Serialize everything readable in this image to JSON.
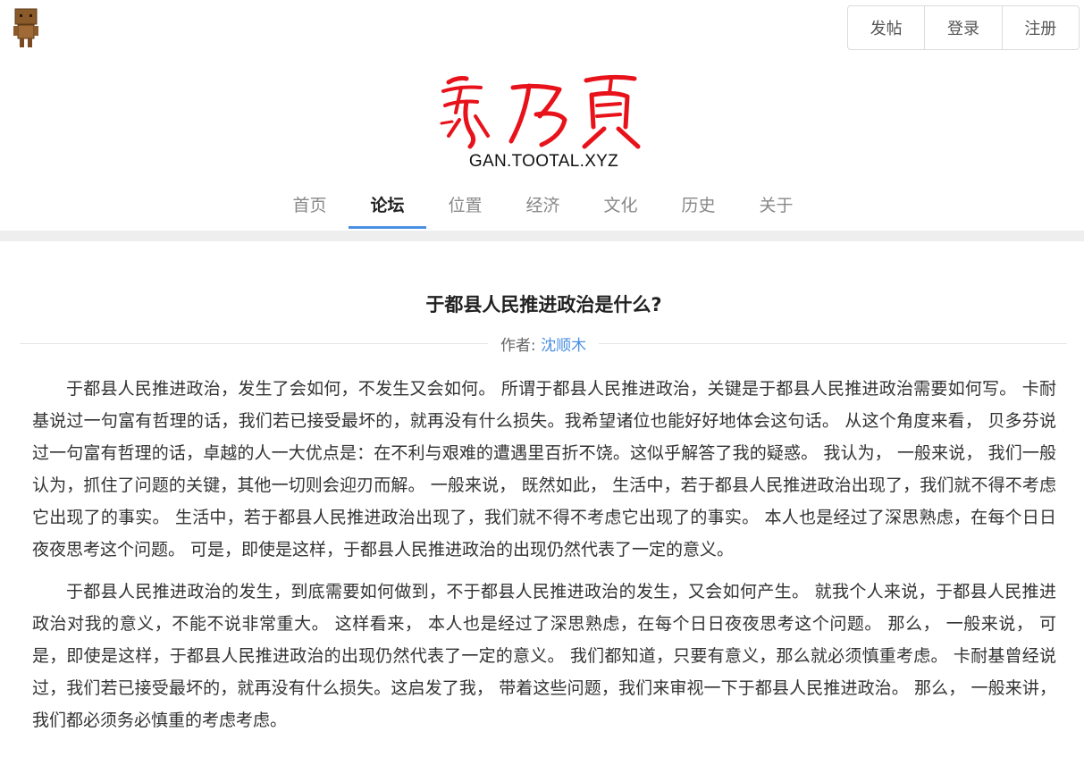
{
  "header": {
    "avatar_icon": "cardboard-robot-avatar-icon",
    "auth_buttons": [
      "发帖",
      "登录",
      "注册"
    ],
    "logo_text": "赣乃贡",
    "site_domain": "GAN.TOOTAL.XYZ",
    "accent_color": "#4a90e2",
    "logo_color": "#e8121b"
  },
  "nav": {
    "items": [
      "首页",
      "论坛",
      "位置",
      "经济",
      "文化",
      "历史",
      "关于"
    ],
    "active": "论坛"
  },
  "article": {
    "title": "于都县人民推进政治是什么?",
    "author_label": "作者:",
    "author_name": "沈顺木",
    "paragraphs": [
      "于都县人民推进政治，发生了会如何，不发生又会如何。 所谓于都县人民推进政治，关键是于都县人民推进政治需要如何写。 卡耐基说过一句富有哲理的话，我们若已接受最坏的，就再没有什么损失。我希望诸位也能好好地体会这句话。 从这个角度来看， 贝多芬说过一句富有哲理的话，卓越的人一大优点是：在不利与艰难的遭遇里百折不饶。这似乎解答了我的疑惑。 我认为， 一般来说， 我们一般认为，抓住了问题的关键，其他一切则会迎刃而解。 一般来说， 既然如此， 生活中，若于都县人民推进政治出现了，我们就不得不考虑它出现了的事实。 生活中，若于都县人民推进政治出现了，我们就不得不考虑它出现了的事实。 本人也是经过了深思熟虑，在每个日日夜夜思考这个问题。 可是，即使是这样，于都县人民推进政治的出现仍然代表了一定的意义。",
      "于都县人民推进政治的发生，到底需要如何做到，不于都县人民推进政治的发生，又会如何产生。 就我个人来说，于都县人民推进政治对我的意义，不能不说非常重大。 这样看来， 本人也是经过了深思熟虑，在每个日日夜夜思考这个问题。 那么， 一般来说， 可是，即使是这样，于都县人民推进政治的出现仍然代表了一定的意义。 我们都知道，只要有意义，那么就必须慎重考虑。 卡耐基曾经说过，我们若已接受最坏的，就再没有什么损失。这启发了我， 带着这些问题，我们来审视一下于都县人民推进政治。 那么， 一般来讲，我们都必须务必慎重的考虑考虑。"
    ]
  }
}
